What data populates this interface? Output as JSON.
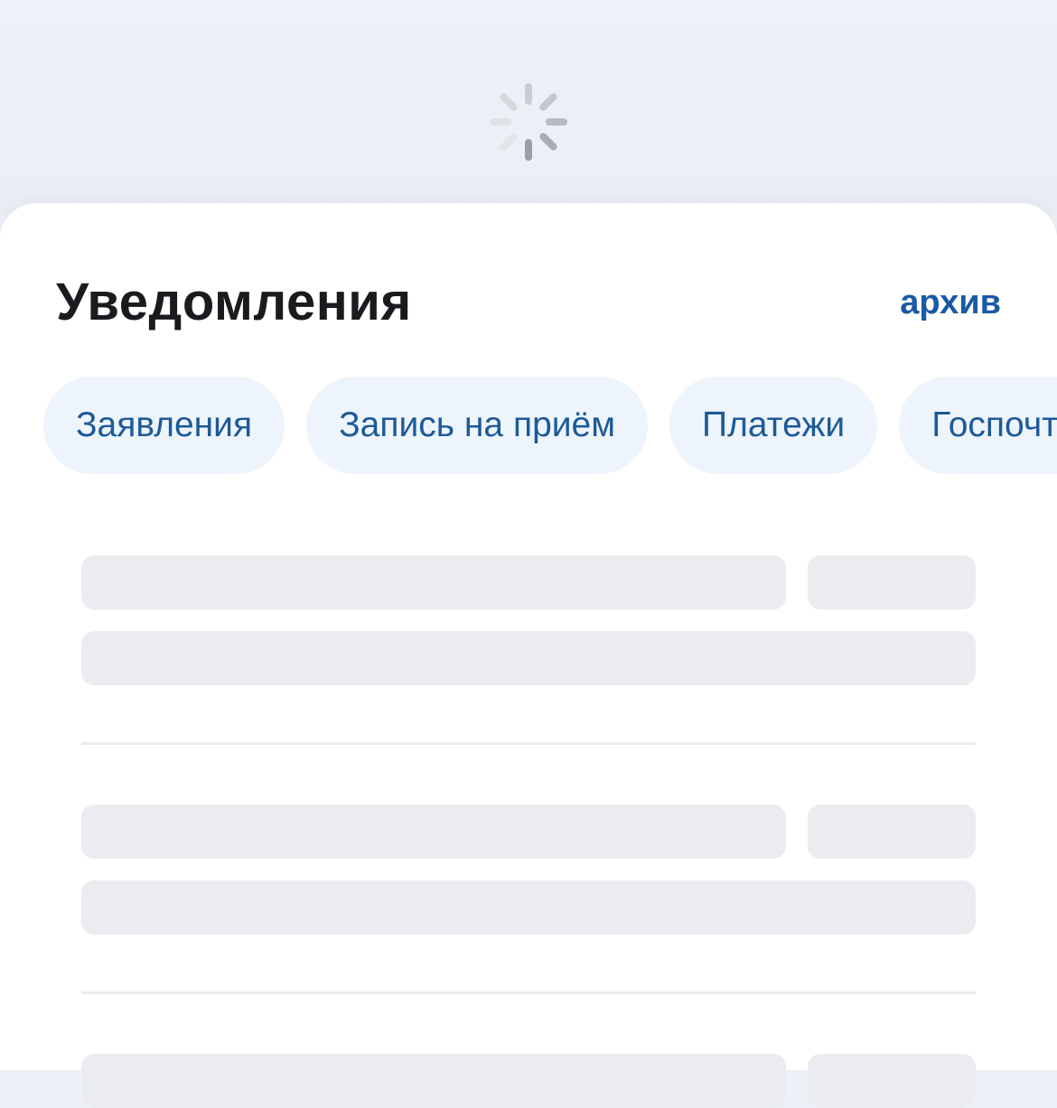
{
  "header": {
    "title": "Уведомления",
    "archive_label": "архив"
  },
  "filters": {
    "chips": [
      {
        "label": "Заявления"
      },
      {
        "label": "Запись на приём"
      },
      {
        "label": "Платежи"
      },
      {
        "label": "Госпочта"
      }
    ]
  },
  "loading": {
    "spinner_icon": "spinner-icon",
    "state": "loading"
  },
  "colors": {
    "background": "#edf1f7",
    "accent": "#1a5aa6",
    "chip_bg": "#eef4fb",
    "chip_text": "#1d5a98",
    "skeleton": "#ebecef"
  }
}
